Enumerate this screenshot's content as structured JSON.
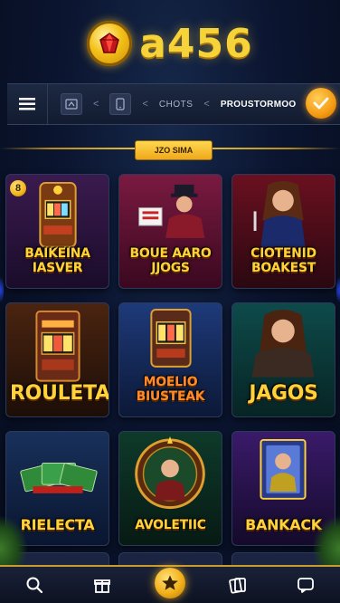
{
  "brand": {
    "logo_text": "a456",
    "logo_icon": "gem-coin-icon"
  },
  "navbar": {
    "menu_icon": "hamburger-menu-icon",
    "items": [
      {
        "icon": "slot-machine-icon",
        "label": ""
      },
      {
        "icon": "phone-icon",
        "label": ""
      },
      {
        "icon": "",
        "label": "CHOTS"
      },
      {
        "icon": "",
        "label": "PROUSTORMOO"
      }
    ],
    "separator": "<",
    "confirm_icon": "check-icon"
  },
  "section": {
    "label": "JZO SIMA"
  },
  "games": [
    {
      "title": "BAIKEINA\nIASVER",
      "badge": "8",
      "theme": "slot-machine-purple"
    },
    {
      "title": "BOUE AARO\nJJOGS",
      "badge": "",
      "theme": "dealer-crimson"
    },
    {
      "title": "CIOTENID\nBOAKEST",
      "badge": "",
      "theme": "woman-red"
    },
    {
      "title": "ROULETA",
      "badge": "",
      "theme": "slot-machine-orange"
    },
    {
      "title": "MOELIO\nBIUSTEAK",
      "badge": "",
      "theme": "slot-machine-blue"
    },
    {
      "title": "JAGOS",
      "badge": "",
      "theme": "woman-teal"
    },
    {
      "title": "RIELECTA",
      "badge": "",
      "theme": "cash-green"
    },
    {
      "title": "AVOLETIIC",
      "badge": "",
      "theme": "roulette-green"
    },
    {
      "title": "BANKACK",
      "badge": "",
      "theme": "cards-violet"
    }
  ],
  "bottom_nav": [
    {
      "icon": "search-icon",
      "label": ""
    },
    {
      "icon": "gift-icon",
      "label": ""
    },
    {
      "icon": "star-icon",
      "label": ""
    },
    {
      "icon": "cards-icon",
      "label": ""
    },
    {
      "icon": "chat-icon",
      "label": ""
    }
  ],
  "colors": {
    "accent_gold": "#f7d33a",
    "background": "#0b1530",
    "confirm_orange": "#f59a12"
  }
}
